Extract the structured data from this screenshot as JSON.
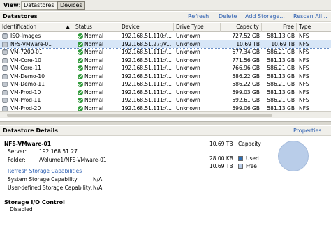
{
  "view": {
    "label": "View:",
    "tabs": [
      {
        "label": "Datastores",
        "active": false
      },
      {
        "label": "Devices",
        "active": true
      }
    ]
  },
  "datastores": {
    "title": "Datastores",
    "actions": {
      "refresh": "Refresh",
      "delete": "Delete",
      "add_storage": "Add Storage...",
      "rescan_all": "Rescan All..."
    },
    "columns": [
      "Identification",
      "Status",
      "Device",
      "Drive Type",
      "Capacity",
      "Free",
      "Type"
    ],
    "rows": [
      {
        "name": "ISO-Images",
        "status": "Normal",
        "device": "192.168.51.110:/...",
        "drive_type": "Unknown",
        "capacity": "727.52 GB",
        "free": "581.13 GB",
        "type": "NFS",
        "selected": false
      },
      {
        "name": "NFS-VMware-01",
        "status": "Normal",
        "device": "192.168.51.27:/V...",
        "drive_type": "Unknown",
        "capacity": "10.69 TB",
        "free": "10.69 TB",
        "type": "NFS",
        "selected": true
      },
      {
        "name": "VM-7200-01",
        "status": "Normal",
        "device": "192.168.51.111:/...",
        "drive_type": "Unknown",
        "capacity": "677.34 GB",
        "free": "586.21 GB",
        "type": "NFS",
        "selected": false
      },
      {
        "name": "VM-Core-10",
        "status": "Normal",
        "device": "192.168.51.111:/...",
        "drive_type": "Unknown",
        "capacity": "771.56 GB",
        "free": "581.13 GB",
        "type": "NFS",
        "selected": false
      },
      {
        "name": "VM-Core-11",
        "status": "Normal",
        "device": "192.168.51.111:/...",
        "drive_type": "Unknown",
        "capacity": "766.96 GB",
        "free": "586.21 GB",
        "type": "NFS",
        "selected": false
      },
      {
        "name": "VM-Demo-10",
        "status": "Normal",
        "device": "192.168.51.111:/...",
        "drive_type": "Unknown",
        "capacity": "586.22 GB",
        "free": "581.13 GB",
        "type": "NFS",
        "selected": false
      },
      {
        "name": "VM-Demo-11",
        "status": "Normal",
        "device": "192.168.51.111:/...",
        "drive_type": "Unknown",
        "capacity": "586.22 GB",
        "free": "586.21 GB",
        "type": "NFS",
        "selected": false
      },
      {
        "name": "VM-Prod-10",
        "status": "Normal",
        "device": "192.168.51.111:/...",
        "drive_type": "Unknown",
        "capacity": "599.03 GB",
        "free": "581.13 GB",
        "type": "NFS",
        "selected": false
      },
      {
        "name": "VM-Prod-11",
        "status": "Normal",
        "device": "192.168.51.111:/...",
        "drive_type": "Unknown",
        "capacity": "592.61 GB",
        "free": "586.21 GB",
        "type": "NFS",
        "selected": false
      },
      {
        "name": "VM-Prod-20",
        "status": "Normal",
        "device": "192.168.51.111:/...",
        "drive_type": "Unknown",
        "capacity": "599.06 GB",
        "free": "581.13 GB",
        "type": "NFS",
        "selected": false
      }
    ]
  },
  "details": {
    "title": "Datastore Details",
    "properties_link": "Properties...",
    "name": "NFS-VMware-01",
    "server_label": "Server:",
    "server": "192.168.51.27",
    "folder_label": "Folder:",
    "folder": "/Volume1/NFS-VMware-01",
    "refresh_link": "Refresh Storage Capabilities",
    "sys_cap_label": "System Storage Capability:",
    "sys_cap": "N/A",
    "user_cap_label": "User-defined Storage Capability:",
    "user_cap": "N/A",
    "capacity_value": "10.69 TB",
    "capacity_label": "Capacity",
    "used_value": "28.00 KB",
    "used_label": "Used",
    "free_value": "10.69 TB",
    "free_label": "Free",
    "colors": {
      "used": "#2d6fb7",
      "free": "#b9cde9"
    },
    "sioc_title": "Storage I/O Control",
    "sioc_value": "Disabled"
  }
}
